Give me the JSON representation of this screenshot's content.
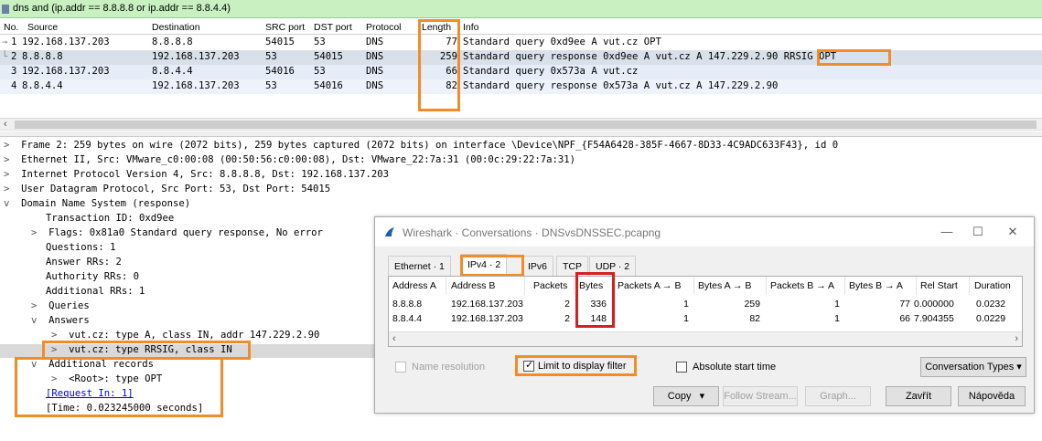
{
  "filter": {
    "text": "dns and (ip.addr == 8.8.8.8 or ip.addr == 8.8.4.4)"
  },
  "packet_list": {
    "columns": [
      "No.",
      "Source",
      "Destination",
      "SRC port",
      "DST port",
      "Protocol",
      "Length",
      "Info"
    ],
    "rows": [
      {
        "no": "1",
        "source": "192.168.137.203",
        "destination": "8.8.8.8",
        "src_port": "54015",
        "dst_port": "53",
        "protocol": "DNS",
        "length": "77",
        "info": "Standard query 0xd9ee A vut.cz OPT"
      },
      {
        "no": "2",
        "source": "8.8.8.8",
        "destination": "192.168.137.203",
        "src_port": "53",
        "dst_port": "54015",
        "protocol": "DNS",
        "length": "259",
        "info": "Standard query response 0xd9ee A vut.cz A 147.229.2.90 RRSIG OPT"
      },
      {
        "no": "3",
        "source": "192.168.137.203",
        "destination": "8.8.4.4",
        "src_port": "54016",
        "dst_port": "53",
        "protocol": "DNS",
        "length": "66",
        "info": "Standard query 0x573a A vut.cz"
      },
      {
        "no": "4",
        "source": "8.8.4.4",
        "destination": "192.168.137.203",
        "src_port": "53",
        "dst_port": "54016",
        "protocol": "DNS",
        "length": "82",
        "info": "Standard query response 0x573a A vut.cz A 147.229.2.90"
      }
    ]
  },
  "details": {
    "lines": [
      {
        "twisty": ">",
        "text": "Frame 2: 259 bytes on wire (2072 bits), 259 bytes captured (2072 bits) on interface \\Device\\NPF_{F54A6428-385F-4667-8D33-4C9ADC633F43}, id 0"
      },
      {
        "twisty": ">",
        "text": "Ethernet II, Src: VMware_c0:00:08 (00:50:56:c0:00:08), Dst: VMware_22:7a:31 (00:0c:29:22:7a:31)"
      },
      {
        "twisty": ">",
        "text": "Internet Protocol Version 4, Src: 8.8.8.8, Dst: 192.168.137.203"
      },
      {
        "twisty": ">",
        "text": "User Datagram Protocol, Src Port: 53, Dst Port: 54015"
      },
      {
        "twisty": "v",
        "text": "Domain Name System (response)"
      },
      {
        "twisty": "",
        "text": "Transaction ID: 0xd9ee"
      },
      {
        "twisty": ">",
        "text": "Flags: 0x81a0 Standard query response, No error"
      },
      {
        "twisty": "",
        "text": "Questions: 1"
      },
      {
        "twisty": "",
        "text": "Answer RRs: 2"
      },
      {
        "twisty": "",
        "text": "Authority RRs: 0"
      },
      {
        "twisty": "",
        "text": "Additional RRs: 1"
      },
      {
        "twisty": ">",
        "text": "Queries"
      },
      {
        "twisty": "v",
        "text": "Answers"
      },
      {
        "twisty": ">",
        "text": "vut.cz: type A, class IN, addr 147.229.2.90"
      },
      {
        "twisty": ">",
        "text": "vut.cz: type RRSIG, class IN"
      },
      {
        "twisty": "v",
        "text": "Additional records"
      },
      {
        "twisty": ">",
        "text": "<Root>: type OPT"
      },
      {
        "twisty": "",
        "text": "[Request In: 1]"
      },
      {
        "twisty": "",
        "text": "[Time: 0.023245000 seconds]"
      }
    ]
  },
  "dialog": {
    "title": "Wireshark · Conversations · DNSvsDNSSEC.pcapng",
    "tabs": [
      "Ethernet · 1",
      "IPv4 · 2",
      "IPv6",
      "TCP",
      "UDP · 2"
    ],
    "active_tab": "IPv4 · 2",
    "columns": [
      "Address A",
      "Address B",
      "Packets",
      "Bytes",
      "Packets A → B",
      "Bytes A → B",
      "Packets B → A",
      "Bytes B → A",
      "Rel Start",
      "Duration"
    ],
    "rows": [
      {
        "address_a": "8.8.8.8",
        "address_b": "192.168.137.203",
        "packets": "2",
        "bytes": "336",
        "packets_ab": "1",
        "bytes_ab": "259",
        "packets_ba": "1",
        "bytes_ba": "77",
        "rel_start": "0.000000",
        "duration": "0.0232"
      },
      {
        "address_a": "8.8.4.4",
        "address_b": "192.168.137.203",
        "packets": "2",
        "bytes": "148",
        "packets_ab": "1",
        "bytes_ab": "82",
        "packets_ba": "1",
        "bytes_ba": "66",
        "rel_start": "7.904355",
        "duration": "0.0229"
      }
    ],
    "name_resolution_label": "Name resolution",
    "limit_filter_label": "Limit to display filter",
    "absolute_time_label": "Absolute start time",
    "conv_types_label": "Conversation Types",
    "buttons": {
      "copy": "Copy",
      "follow_stream": "Follow Stream...",
      "graph": "Graph...",
      "close": "Zavřít",
      "help": "Nápověda"
    },
    "limit_filter_checked": true
  },
  "colors": {
    "highlight": "#f28c28",
    "bytes_highlight": "#d62020",
    "filter_bg": "#c8f0c0"
  }
}
